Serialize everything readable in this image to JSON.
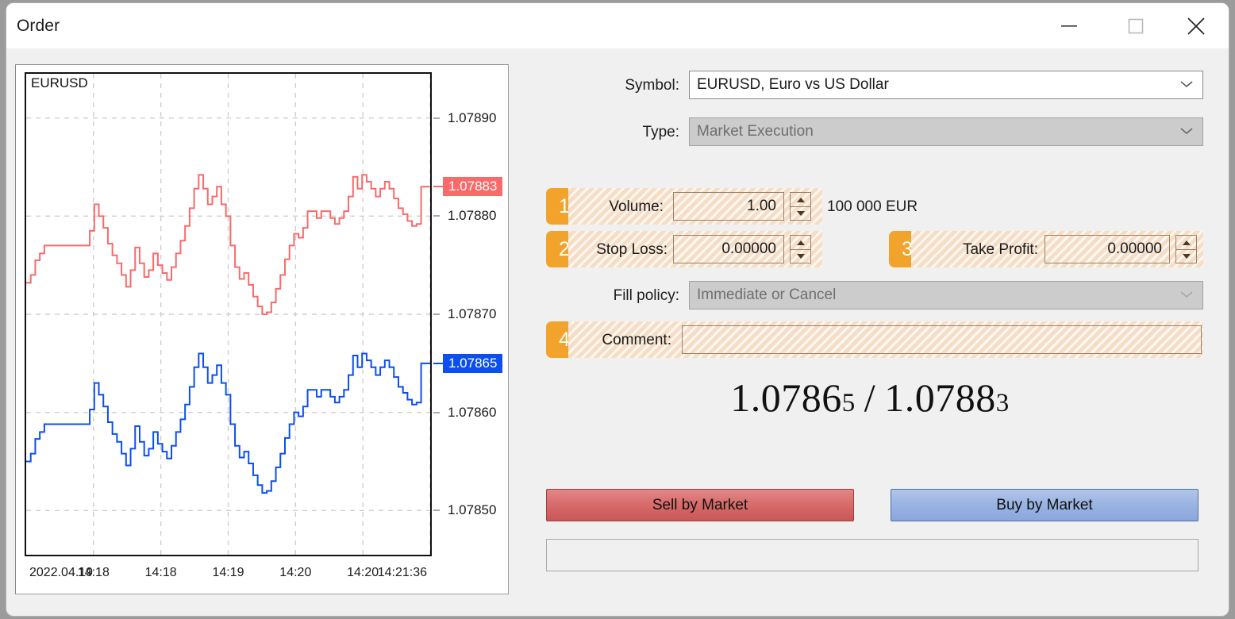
{
  "window": {
    "title": "Order",
    "controls": {
      "minimize": "minimize-icon",
      "maximize": "maximize-icon",
      "close": "close-icon"
    }
  },
  "chart": {
    "symbol_label": "EURUSD",
    "bid_badge": "1.07865",
    "ask_badge": "1.07883",
    "bid_color": "#0b4ff0",
    "ask_color": "#f96a6a",
    "y_ticks": [
      "1.07890",
      "1.07880",
      "1.07870",
      "1.07860",
      "1.07850"
    ],
    "x_ticks": [
      "2022.04.19",
      "14:18",
      "14:18",
      "14:19",
      "14:20",
      "14:20",
      "14:21:36"
    ]
  },
  "chart_data": {
    "type": "line",
    "title": "EURUSD",
    "xlabel": "",
    "ylabel": "",
    "ylim": [
      1.078455,
      1.078945
    ],
    "yticks": [
      1.0789,
      1.0788,
      1.0787,
      1.0786,
      1.0785
    ],
    "xticklabels": [
      "2022.04.19",
      "14:18",
      "14:18",
      "14:19",
      "14:20",
      "14:20",
      "14:21:36"
    ],
    "grid": true,
    "legend": "none",
    "annotations": [
      {
        "label": "1.07883",
        "value": 1.07883,
        "series": "Ask",
        "color": "#f96a6a"
      },
      {
        "label": "1.07865",
        "value": 1.07865,
        "series": "Bid",
        "color": "#0b4ff0"
      }
    ],
    "series": [
      {
        "name": "Ask",
        "color": "#f96a6a",
        "values": [
          1.078732,
          1.07874,
          1.078755,
          1.078762,
          1.07877,
          1.07877,
          1.07877,
          1.07877,
          1.07877,
          1.07877,
          1.07877,
          1.07877,
          1.07877,
          1.07877,
          1.078785,
          1.078812,
          1.0788,
          1.078788,
          1.078772,
          1.07876,
          1.078752,
          1.07874,
          1.078728,
          1.078745,
          1.078768,
          1.078752,
          1.078738,
          1.078745,
          1.078762,
          1.07875,
          1.078742,
          1.078735,
          1.078748,
          1.078762,
          1.078775,
          1.07879,
          1.078808,
          1.078828,
          1.078842,
          1.078828,
          1.078812,
          1.07882,
          1.07883,
          1.078812,
          1.0788,
          1.07877,
          1.078748,
          1.078736,
          1.078742,
          1.07873,
          1.078718,
          1.078708,
          1.0787,
          1.078702,
          1.078712,
          1.078726,
          1.07874,
          1.078756,
          1.07877,
          1.078782,
          1.078778,
          1.078788,
          1.078805,
          1.078805,
          1.078798,
          1.078805,
          1.078805,
          1.078798,
          1.078792,
          1.078798,
          1.078805,
          1.07882,
          1.07884,
          1.078828,
          1.078842,
          1.078835,
          1.078828,
          1.07882,
          1.078828,
          1.078835,
          1.078828,
          1.078818,
          1.078808,
          1.078802,
          1.078795,
          1.07879,
          1.078792,
          1.07883,
          1.07883,
          1.07883
        ]
      },
      {
        "name": "Bid",
        "color": "#0b4ff0",
        "values": [
          1.07855,
          1.078558,
          1.078573,
          1.07858,
          1.078588,
          1.078588,
          1.078588,
          1.078588,
          1.078588,
          1.078588,
          1.078588,
          1.078588,
          1.078588,
          1.078588,
          1.078603,
          1.07863,
          1.078618,
          1.078606,
          1.07859,
          1.078578,
          1.07857,
          1.078558,
          1.078546,
          1.078563,
          1.078586,
          1.07857,
          1.078556,
          1.078563,
          1.07858,
          1.078568,
          1.07856,
          1.078553,
          1.078566,
          1.07858,
          1.078593,
          1.078608,
          1.078626,
          1.078646,
          1.07866,
          1.078646,
          1.07863,
          1.078638,
          1.078648,
          1.07863,
          1.078618,
          1.078588,
          1.078566,
          1.078554,
          1.07856,
          1.078548,
          1.078536,
          1.078526,
          1.078518,
          1.07852,
          1.07853,
          1.078544,
          1.078558,
          1.078574,
          1.078588,
          1.0786,
          1.078596,
          1.078606,
          1.078623,
          1.078623,
          1.078616,
          1.078623,
          1.078623,
          1.078616,
          1.07861,
          1.078616,
          1.078623,
          1.078638,
          1.078658,
          1.078646,
          1.07866,
          1.078653,
          1.078646,
          1.078638,
          1.078646,
          1.078653,
          1.078646,
          1.078636,
          1.078626,
          1.07862,
          1.078613,
          1.078608,
          1.07861,
          1.07865,
          1.07865,
          1.07865
        ]
      }
    ]
  },
  "form": {
    "symbol": {
      "label": "Symbol:",
      "value": "EURUSD, Euro vs US Dollar"
    },
    "type": {
      "label": "Type:",
      "value": "Market Execution"
    },
    "volume": {
      "badge": "1",
      "label": "Volume:",
      "value": "1.00",
      "note": "100 000 EUR"
    },
    "stop_loss": {
      "badge": "2",
      "label": "Stop Loss:",
      "value": "0.00000"
    },
    "take_profit": {
      "badge": "3",
      "label": "Take Profit:",
      "value": "0.00000"
    },
    "fill_policy": {
      "label": "Fill policy:",
      "value": "Immediate or Cancel"
    },
    "comment": {
      "badge": "4",
      "label": "Comment:",
      "value": "",
      "placeholder": ""
    }
  },
  "quote": {
    "bid_main": "1.0786",
    "bid_last": "5",
    "separator": "/",
    "ask_main": "1.0788",
    "ask_last": "3"
  },
  "buttons": {
    "sell": "Sell by Market",
    "buy": "Buy by Market"
  },
  "status": {
    "text": ""
  },
  "colors": {
    "badge_orange": "#f2a32b",
    "sell_red": "#d96c6c",
    "buy_blue": "#9bb4e2",
    "highlight": "#f6dec6"
  }
}
